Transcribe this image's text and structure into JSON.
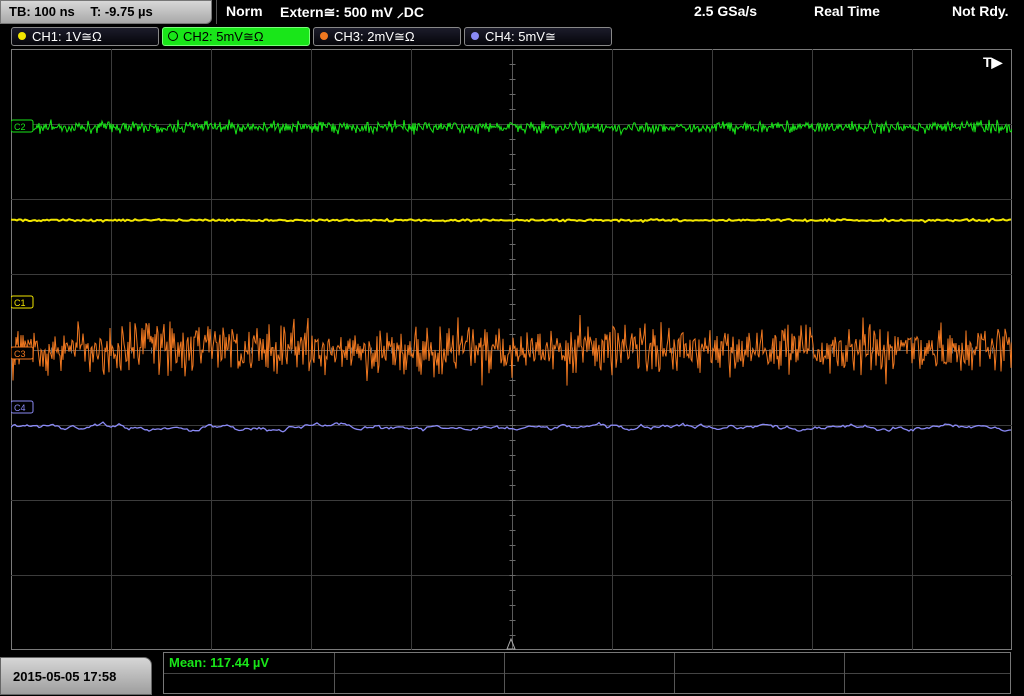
{
  "status_bar": {
    "timebase": "TB: 100 ns",
    "trigger_time": "T: -9.75 µs",
    "mode": "Norm",
    "trigger": "Extern≅: 500 mV ⸝DC",
    "sample_rate": "2.5 GSa/s",
    "acq_mode": "Real Time",
    "status": "Not Rdy."
  },
  "channels": [
    {
      "label": "CH1: 1V≅Ω",
      "color": "#f2e600",
      "active": false
    },
    {
      "label": "CH2: 5mV≅Ω",
      "color": "#19e619",
      "active": true
    },
    {
      "label": "CH3: 2mV≅Ω",
      "color": "#f07820",
      "active": false
    },
    {
      "label": "CH4: 5mV≅",
      "color": "#8a8af5",
      "active": false
    }
  ],
  "markers": {
    "trigger": "T▶",
    "c1": "C1",
    "c2": "C2",
    "c3": "C3",
    "c4": "C4"
  },
  "traces": {
    "ch1_level": 0.285,
    "ch2_level": 0.13,
    "ch3_level": 0.5,
    "ch4_level": 0.63
  },
  "bottom": {
    "datetime": "2015-05-05 17:58",
    "measurement": "Mean: 117.44 µV"
  }
}
